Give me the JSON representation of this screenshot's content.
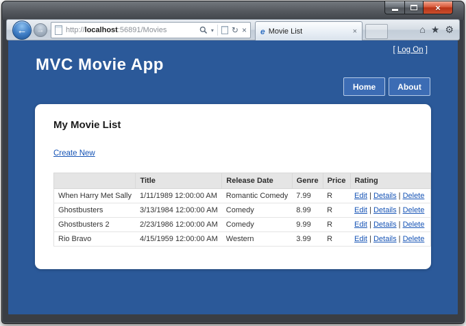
{
  "browser": {
    "url": {
      "prefix": "http://",
      "host": "localhost",
      "rest": ":56891/Movies"
    },
    "tab": {
      "title": "Movie List"
    },
    "icons": {
      "back": "←",
      "forward": "→",
      "dropdown": "▾",
      "refresh": "↻",
      "stop": "×",
      "home": "⌂",
      "favorites": "★",
      "tools": "⚙",
      "ie_logo": "e",
      "tab_close": "×",
      "window_close": "×",
      "search": "magnifier-icon",
      "compatibility": "page-icon"
    }
  },
  "page": {
    "logon": {
      "prefix": "[ ",
      "link": "Log On",
      "suffix": " ]"
    },
    "title": "MVC Movie App",
    "nav": {
      "home": "Home",
      "about": "About"
    },
    "section": {
      "heading": "My Movie List",
      "create_link": "Create New"
    },
    "table": {
      "headers": [
        "",
        "Title",
        "Release Date",
        "Genre",
        "Price",
        "Rating"
      ],
      "rows": [
        {
          "name": "When Harry Met Sally",
          "release_date": "1/11/1989 12:00:00 AM",
          "genre": "Romantic Comedy",
          "price": "7.99",
          "rating": "R"
        },
        {
          "name": "Ghostbusters",
          "release_date": "3/13/1984 12:00:00 AM",
          "genre": "Comedy",
          "price": "8.99",
          "rating": "R"
        },
        {
          "name": "Ghostbusters 2",
          "release_date": "2/23/1986 12:00:00 AM",
          "genre": "Comedy",
          "price": "9.99",
          "rating": "R"
        },
        {
          "name": "Rio Bravo",
          "release_date": "4/15/1959 12:00:00 AM",
          "genre": "Western",
          "price": "3.99",
          "rating": "R"
        }
      ],
      "actions": {
        "edit": "Edit",
        "details": "Details",
        "delete": "Delete",
        "separator": "|"
      }
    }
  },
  "colors": {
    "page_background": "#2b5999",
    "nav_button_blue": "#3c6cb4",
    "link_blue": "#1553b5",
    "close_button_red": "#b93418",
    "table_header_gray": "#e5e5e5"
  }
}
